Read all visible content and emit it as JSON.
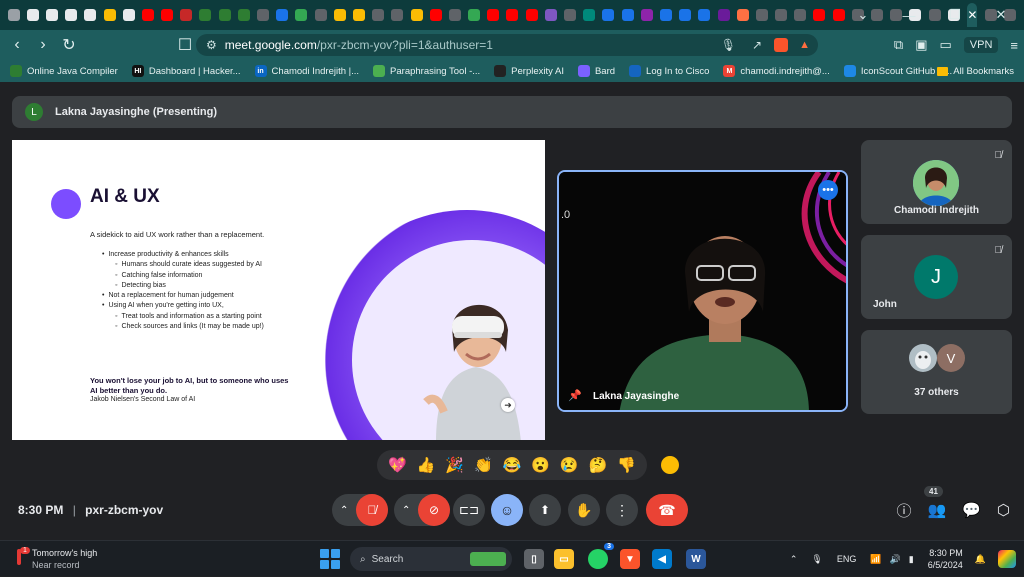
{
  "browser": {
    "tab_colors": [
      "#9aa0a6",
      "#e8eaed",
      "#e8eaed",
      "#e8eaed",
      "#e8eaed",
      "#fbbc04",
      "#e8eaed",
      "#ff0000",
      "#ff0000",
      "#c62828",
      "#2e7d32",
      "#2e7d32",
      "#2e7d32",
      "#5f6368",
      "#1a73e8",
      "#34a853",
      "#5f6368",
      "#fbbc04",
      "#fbbc04",
      "#5f6368",
      "#5f6368",
      "#fbbc04",
      "#ff0000",
      "#5f6368",
      "#34a853",
      "#ff0000",
      "#ff0000",
      "#ff0000",
      "#7e57c2",
      "#5f6368",
      "#00897b",
      "#1a73e8",
      "#1a73e8",
      "#8e24aa",
      "#1a73e8",
      "#1a73e8",
      "#1a73e8",
      "#6a1b9a",
      "#ff7043",
      "#5f6368",
      "#5f6368",
      "#5f6368",
      "#ff0000",
      "#ff0000",
      "#5f6368",
      "#5f6368",
      "#5f6368",
      "#e8eaed",
      "#5f6368",
      "#e8eaed",
      "#5f6368",
      "#5f6368"
    ],
    "active_tab_icon": "✕",
    "new_tab": "+",
    "url_host": "meet.google.com",
    "url_path": "/pxr-zbcm-yov?pli=1&authuser=1",
    "vpn_label": "VPN",
    "bookmarks": [
      {
        "label": "Online Java Compiler",
        "color": "#2e7d32",
        "glyph": ""
      },
      {
        "label": "Dashboard | Hacker...",
        "color": "#111111",
        "glyph": "HI"
      },
      {
        "label": "Chamodi Indrejith |...",
        "color": "#0a66c2",
        "glyph": "in"
      },
      {
        "label": "Paraphrasing Tool -...",
        "color": "#4caf50",
        "glyph": ""
      },
      {
        "label": "Perplexity AI",
        "color": "#222222",
        "glyph": ""
      },
      {
        "label": "Bard",
        "color": "#7b61ff",
        "glyph": ""
      },
      {
        "label": "Log In to Cisco",
        "color": "#1565c0",
        "glyph": ""
      },
      {
        "label": "chamodi.indrejith@...",
        "color": "#ea4335",
        "glyph": "M"
      },
      {
        "label": "IconScout GitHub S...",
        "color": "#1e88e5",
        "glyph": ""
      }
    ],
    "all_bookmarks": "All Bookmarks"
  },
  "meet": {
    "presenter_initial": "L",
    "presenter_label": "Lakna Jayasinghe (Presenting)",
    "slide": {
      "title": "AI & UX",
      "subtitle": "A sidekick to aid UX work rather than a replacement.",
      "bullets": [
        {
          "level": 1,
          "text": "Increase productivity & enhances skills"
        },
        {
          "level": 2,
          "text": "Humans should curate ideas suggested by AI"
        },
        {
          "level": 2,
          "text": "Catching false information"
        },
        {
          "level": 2,
          "text": "Detecting bias"
        },
        {
          "level": 1,
          "text": "Not a replacement for human judgement"
        },
        {
          "level": 1,
          "text": "Using AI when you're getting into UX,"
        },
        {
          "level": 2,
          "text": "Treat tools and information as a starting point"
        },
        {
          "level": 2,
          "text": "Check sources and links (It may be made up!)"
        }
      ],
      "quote": "You won't lose your job to AI, but to someone who uses AI better than you do.",
      "author": "Jakob Nielsen's Second Law of AI"
    },
    "camera_name": "Lakna Jayasinghe",
    "participants": [
      {
        "name": "Chamodi Indrejith",
        "initial": "",
        "color": "#4fc3f7"
      },
      {
        "name": "John",
        "initial": "J",
        "color": "#00796b"
      }
    ],
    "others": {
      "label": "37 others",
      "initials": [
        "",
        "V"
      ],
      "colors": [
        "#b0bec5",
        "#8d6e63"
      ]
    },
    "reactions": [
      "💖",
      "👍",
      "🎉",
      "👏",
      "😂",
      "😮",
      "😢",
      "🤔",
      "👎"
    ],
    "time": "8:30 PM",
    "separator": "|",
    "meeting_code": "pxr-zbcm-yov",
    "people_count": "41"
  },
  "taskbar": {
    "weather_title": "Tomorrow's high",
    "weather_sub": "Near record",
    "weather_badge": "1",
    "search_label": "Search",
    "whatsapp_badge": "3",
    "lang": "ENG",
    "clock_time": "8:30 PM",
    "clock_date": "6/5/2024"
  }
}
